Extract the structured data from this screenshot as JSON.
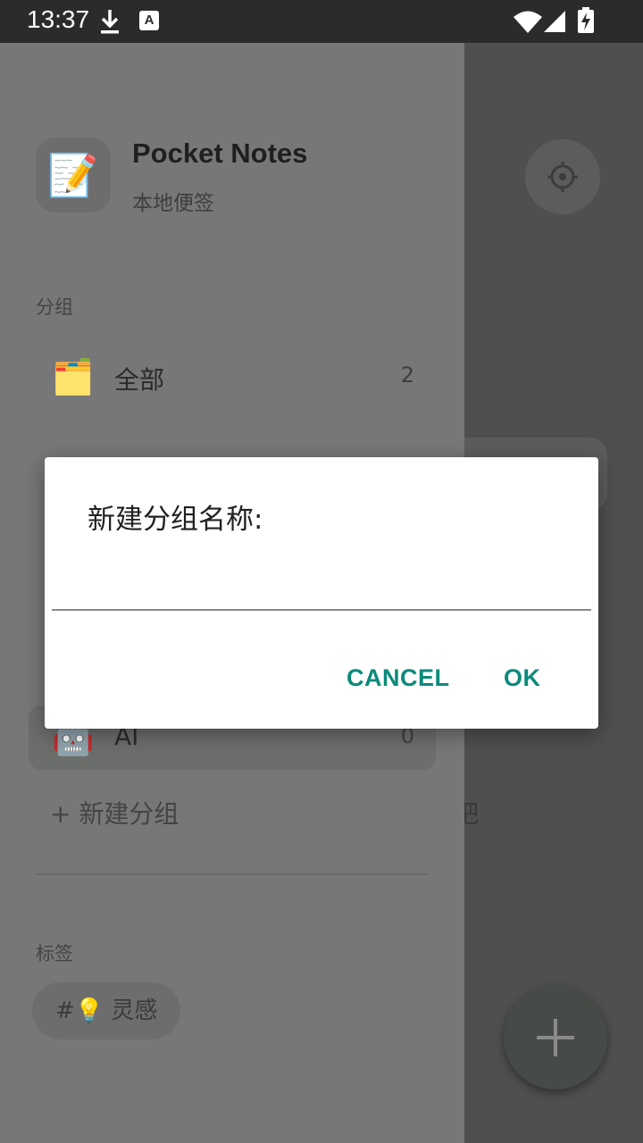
{
  "status_bar": {
    "time": "13:37",
    "notif_letter": "A"
  },
  "app": {
    "name": "Pocket Notes",
    "subtitle": "本地便签",
    "icon": "📝"
  },
  "drawer": {
    "groups_label": "分组",
    "groups": [
      {
        "icon": "🗂️",
        "label": "全部",
        "count": "2"
      },
      {
        "icon": "🤖",
        "label": "AI",
        "count": "0"
      }
    ],
    "new_group": "+ 新建分组",
    "tags_label": "标签",
    "tags": [
      {
        "text": "#💡 灵感"
      }
    ]
  },
  "main": {
    "fragment_text": "吧"
  },
  "dialog": {
    "title": "新建分组名称:",
    "input_value": "",
    "cancel_label": "CANCEL",
    "ok_label": "OK"
  },
  "colors": {
    "accent": "#0b8a7a",
    "status_bar": "#2b2b2b"
  },
  "icons": [
    "download-icon",
    "wifi-icon",
    "signal-icon",
    "battery-charging-icon",
    "settings-icon",
    "plus-icon"
  ]
}
